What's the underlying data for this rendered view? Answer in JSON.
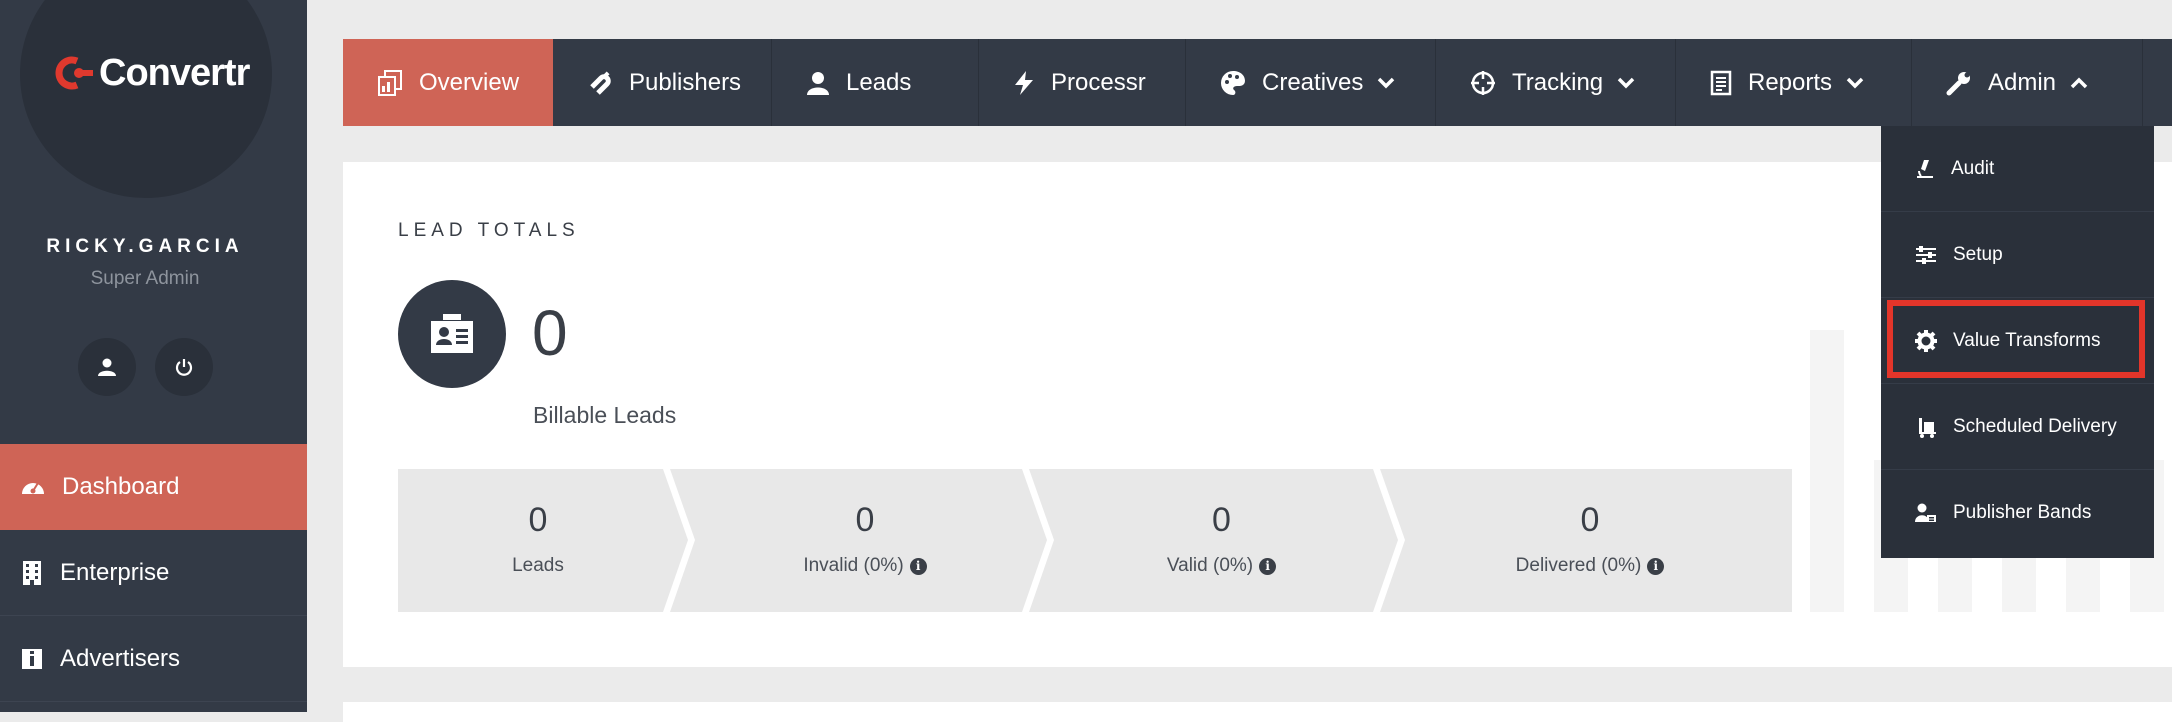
{
  "brand": {
    "name": "Convertr",
    "accent": "#cf6456",
    "dark": "#333a46"
  },
  "user": {
    "name": "RICKY.GARCIA",
    "role": "Super Admin"
  },
  "sidebar": {
    "items": [
      {
        "label": "Dashboard",
        "icon": "dashboard-icon",
        "active": true
      },
      {
        "label": "Enterprise",
        "icon": "building-icon"
      },
      {
        "label": "Advertisers",
        "icon": "advertiser-icon"
      }
    ]
  },
  "topnav": {
    "tabs": [
      {
        "label": "Overview",
        "icon": "overview-icon",
        "active": true
      },
      {
        "label": "Publishers",
        "icon": "magnet-icon"
      },
      {
        "label": "Leads",
        "icon": "user-icon"
      },
      {
        "label": "Processr",
        "icon": "bolt-icon"
      },
      {
        "label": "Creatives",
        "icon": "palette-icon",
        "chevron": "down"
      },
      {
        "label": "Tracking",
        "icon": "crosshair-icon",
        "chevron": "down"
      },
      {
        "label": "Reports",
        "icon": "report-icon",
        "chevron": "down"
      },
      {
        "label": "Admin",
        "icon": "wrench-icon",
        "chevron": "up"
      }
    ]
  },
  "admin_menu": {
    "items": [
      {
        "label": "Audit",
        "icon": "microscope-icon"
      },
      {
        "label": "Setup",
        "icon": "sliders-icon"
      },
      {
        "label": "Value Transforms",
        "icon": "gear-icon",
        "highlighted": true
      },
      {
        "label": "Scheduled Delivery",
        "icon": "delivery-icon"
      },
      {
        "label": "Publisher Bands",
        "icon": "publisher-band-icon"
      }
    ]
  },
  "lead_totals": {
    "title": "LEAD TOTALS",
    "billable_value": "0",
    "billable_label": "Billable Leads",
    "stats": [
      {
        "value": "0",
        "label": "Leads",
        "info": false
      },
      {
        "value": "0",
        "label": "Invalid (0%)",
        "info": true
      },
      {
        "value": "0",
        "label": "Valid (0%)",
        "info": true
      },
      {
        "value": "0",
        "label": "Delivered (0%)",
        "info": true
      }
    ]
  },
  "colors": {
    "highlight": "#e3352a",
    "panel_bg": "#ffffff",
    "page_bg": "#ebebeb",
    "stat_bg": "#e8e8e8"
  }
}
